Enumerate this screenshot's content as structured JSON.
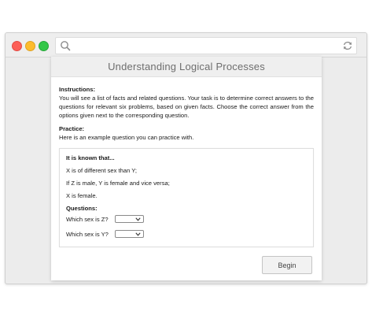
{
  "panel": {
    "title": "Understanding Logical Processes"
  },
  "instructions": {
    "heading": "Instructions:",
    "text": "You will see a list of facts and related questions. Your task is to determine correct answers to the questions for relevant six problems, based on given facts. Choose the correct answer from the options given next to the corresponding question."
  },
  "practice": {
    "heading": "Practice:",
    "text": "Here is an example question you can practice with."
  },
  "example": {
    "title": "It is known that...",
    "facts": [
      "X is of different sex than Y;",
      "If Z is male, Y is female and vice versa;",
      "X is female."
    ],
    "questions_heading": "Questions:",
    "questions": [
      {
        "label": "Which sex is Z?",
        "value": ""
      },
      {
        "label": "Which sex is Y?",
        "value": ""
      }
    ]
  },
  "begin_label": "Begin",
  "icons": {
    "search": "search-icon",
    "reload": "reload-icon"
  }
}
